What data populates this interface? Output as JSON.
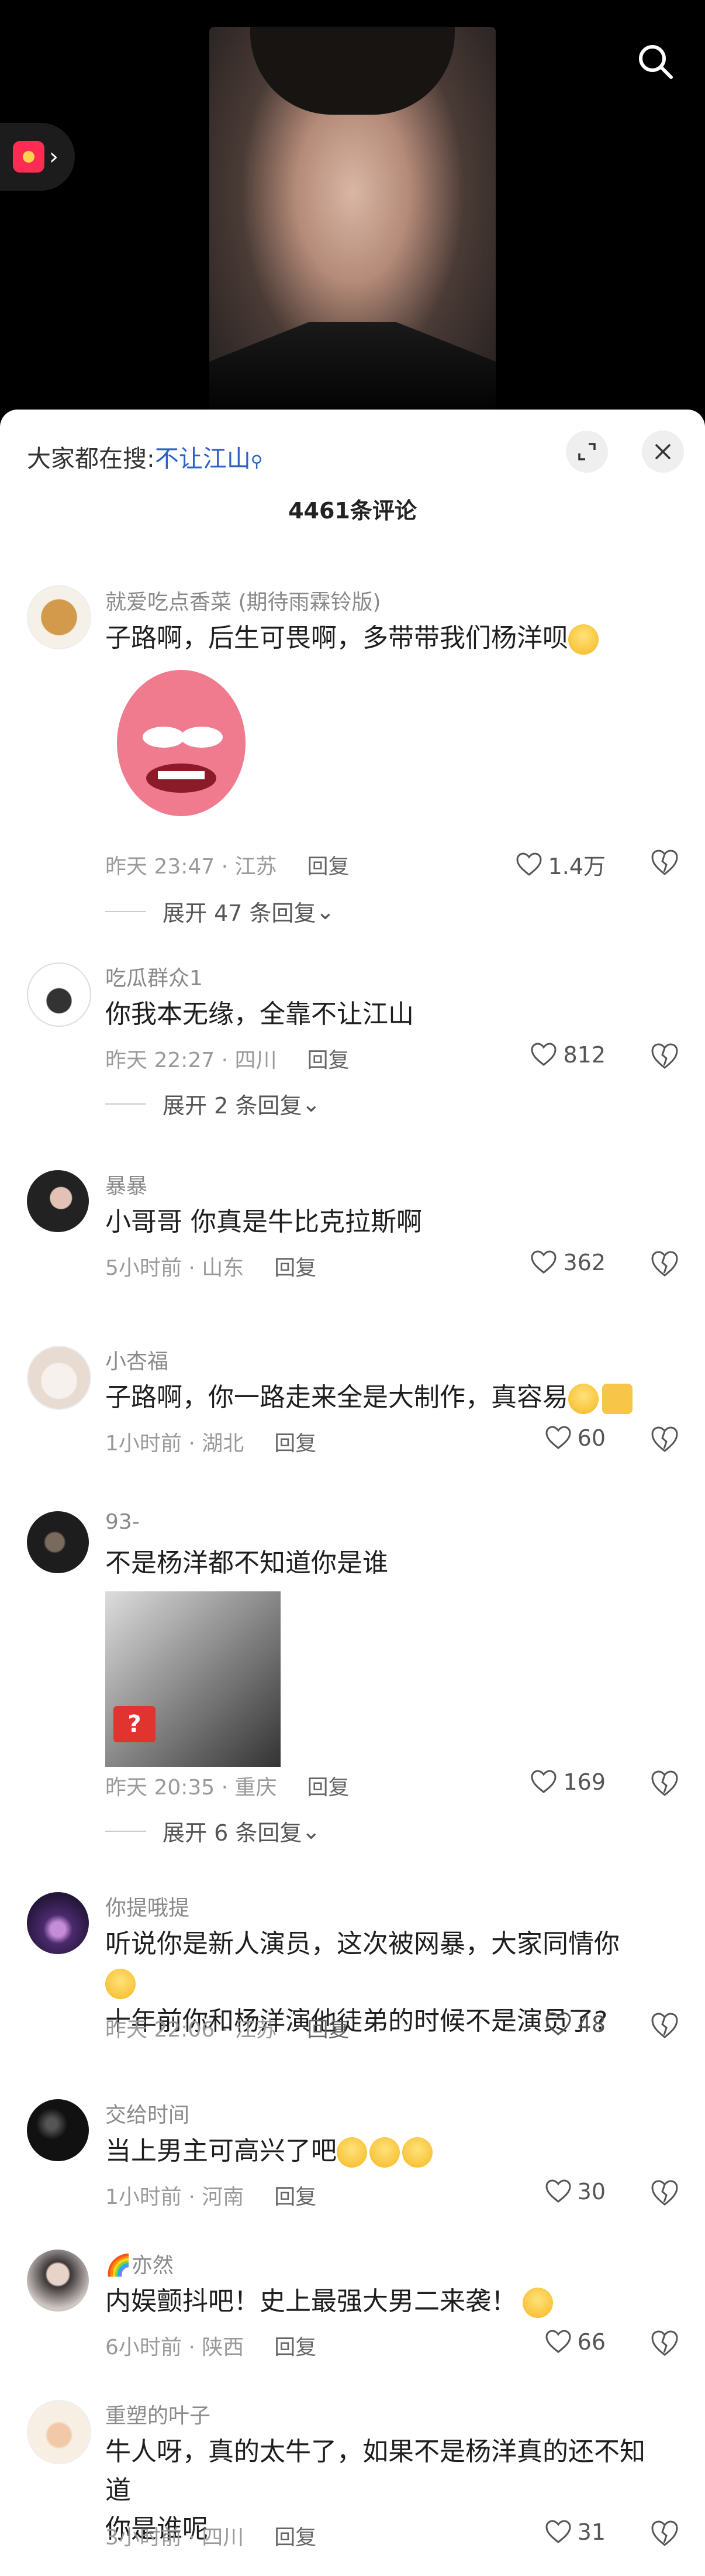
{
  "video": {
    "search_icon": "search-icon",
    "redpacket_icon": "red-envelope-icon"
  },
  "sheet": {
    "search_prefix": "大家都在搜:",
    "search_keyword": "不让江山",
    "comment_count": "4461条评论",
    "expand_icon": "expand-icon",
    "close_icon": "close-icon"
  },
  "comments": [
    {
      "user": "就爱吃点香菜 (期待雨霖铃版)",
      "text": "子路啊，后生可畏啊，多带带我们杨洋呗",
      "emoji": "crying-face",
      "media": "sticker",
      "time": "昨天 23:47 · 江苏",
      "reply": "回复",
      "likes": "1.4万",
      "expand": "展开 47 条回复"
    },
    {
      "user": "吃瓜群众1",
      "text": "你我本无缘，全靠不让江山",
      "time": "昨天 22:27 · 四川",
      "reply": "回复",
      "likes": "812",
      "expand": "展开 2 条回复"
    },
    {
      "user": "暴暴",
      "text": "小哥哥 你真是牛比克拉斯啊",
      "time": "5小时前 · 山东",
      "reply": "回复",
      "likes": "362"
    },
    {
      "user": "小杏福",
      "text": "子路啊，你一路走来全是大制作，真容易",
      "emoji": "pleading-face clapping-hands",
      "time": "1小时前 · 湖北",
      "reply": "回复",
      "likes": "60"
    },
    {
      "user": "93-",
      "text": "不是杨洋都不知道你是谁",
      "media": "lion-image",
      "badge": "?",
      "time": "昨天 20:35 · 重庆",
      "reply": "回复",
      "likes": "169",
      "expand": "展开 6 条回复"
    },
    {
      "user": "你提哦提",
      "text": "听说你是新人演员，这次被网暴，大家同情你",
      "text2": "十年前你和杨洋演他徒弟的时候不是演员了?",
      "emoji": "grinning-face",
      "time": "昨天 22:06 · 江苏",
      "reply": "回复",
      "likes": "48"
    },
    {
      "user": "交给时间",
      "text": "当上男主可高兴了吧",
      "emoji": "face-holding-back-tears x3",
      "time": "1小时前 · 河南",
      "reply": "回复",
      "likes": "30"
    },
    {
      "user": "亦然",
      "text": "内娱颤抖吧！史上最强大男二来袭！",
      "emoji": "smiling-face",
      "time": "6小时前 · 陕西",
      "reply": "回复",
      "likes": "66"
    },
    {
      "user": "重塑的叶子",
      "text": "牛人呀，真的太牛了，如果不是杨洋真的还不知道",
      "text2": "你是谁呢",
      "time": "3小时前 · 四川",
      "reply": "回复",
      "likes": "31"
    }
  ]
}
